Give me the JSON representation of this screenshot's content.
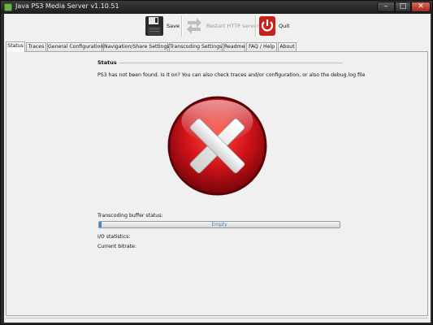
{
  "window": {
    "title": "Java PS3 Media Server v1.10.51",
    "minimize_glyph": "–",
    "maximize_glyph": "□",
    "close_glyph": "✕"
  },
  "toolbar": {
    "save_label": "Save",
    "restart_label": "Restart HTTP server",
    "quit_label": "Quit"
  },
  "tabs": [
    {
      "label": "Status",
      "active": true
    },
    {
      "label": "Traces"
    },
    {
      "label": "General Configuration"
    },
    {
      "label": "Navigation/Share Settings"
    },
    {
      "label": "Transcoding Settings"
    },
    {
      "label": "Readme"
    },
    {
      "label": "FAQ / Help"
    },
    {
      "label": "About"
    }
  ],
  "status": {
    "heading": "Status",
    "message": "PS3 has not been found. Is it on? You can also check traces and/or configuration, or also the debug.log file",
    "big_icon": "error-x-icon",
    "buffer_label": "Transcoding buffer status:",
    "buffer_text": "Empty",
    "buffer_fill_fraction": 0.01,
    "io_label": "I/O statistics:",
    "bitrate_label": "Current bitrate:"
  },
  "colors": {
    "error_red": "#d0131a",
    "quit_red": "#c8201a",
    "progress_blue": "#3b8cd8"
  }
}
